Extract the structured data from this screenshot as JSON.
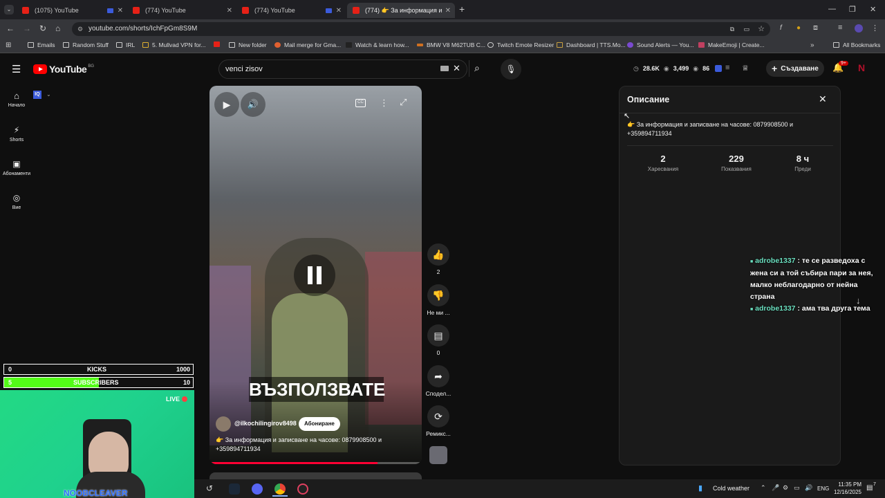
{
  "browser": {
    "tabs": [
      {
        "title": "(1075) YouTube"
      },
      {
        "title": "(774) YouTube"
      },
      {
        "title": "(774) YouTube"
      },
      {
        "title": "(774) 👉 За информация и"
      }
    ],
    "new_tab": "+",
    "url": "youtube.com/shorts/IchFpGm8S9M",
    "bookmarks": [
      "Emails",
      "Random Stuff",
      "IRL",
      "5. Mullvad VPN for...",
      "",
      "New folder",
      "Mail merge for Gma...",
      "Watch & learn how...",
      "BMW V8 M62TUB C...",
      "Twitch Emote Resizer",
      "Dashboard | TTS.Mo...",
      "Sound Alerts — You...",
      "MakeEmoji | Create..."
    ],
    "all_bookmarks": "All Bookmarks"
  },
  "youtube": {
    "logo_text": "YouTube",
    "region": "BG",
    "search_value": "venci zisov",
    "header_stats": {
      "views": "28.6K",
      "watching": "3,499",
      "viewers": "86"
    },
    "create_label": "Създаване",
    "notif_count": "9+",
    "sidebar": [
      {
        "label": "Начало",
        "icon": "home-icon"
      },
      {
        "label": "Shorts",
        "icon": "shorts-icon"
      },
      {
        "label": "Абонаменти",
        "icon": "subscriptions-icon"
      },
      {
        "label": "Вие",
        "icon": "you-icon"
      }
    ],
    "channel_chip": "IQ"
  },
  "video": {
    "big_caption": "ВЪЗПОЛЗВАТЕ",
    "channel": "@ilkochilingirov8498",
    "subscribe_label": "Абониране",
    "description": "👉 За информация и записване на часове: 0879908500 и +359894711934",
    "progress": 0.79,
    "actions": {
      "likes": "2",
      "dislike_label": "Не ми ...",
      "comments": "0",
      "share_label": "Сподел...",
      "remix_label": "Ремикс..."
    }
  },
  "description_panel": {
    "title": "Описание",
    "text": "👉 За информация и записване на часове: 0879908500 и +359894711934",
    "stats": [
      {
        "value": "2",
        "label": "Харесвания"
      },
      {
        "value": "229",
        "label": "Показвания"
      },
      {
        "value": "8 ч",
        "label": "Преди"
      }
    ]
  },
  "chat": [
    {
      "user": "adrobe1337",
      "text": ": те се разведоха с жена си а той събира пари за нея, малко неблагодарно от нейна страна"
    },
    {
      "user": "adrobe1337",
      "text": ": ама тва друга тема"
    }
  ],
  "stream_overlay": {
    "kicks": {
      "label": "KICKS",
      "current": "0",
      "goal": "1000",
      "fill": 0
    },
    "subs": {
      "label": "SUBSCRIBERS",
      "current": "5",
      "goal": "10",
      "fill": 0.5
    },
    "live_label": "LIVE",
    "streamer_name": "NOOBCLEAVER"
  },
  "taskbar": {
    "weather": "Cold weather",
    "lang": "ENG",
    "time": "11:35 PM",
    "date": "12/16/2025",
    "notif": "7"
  }
}
